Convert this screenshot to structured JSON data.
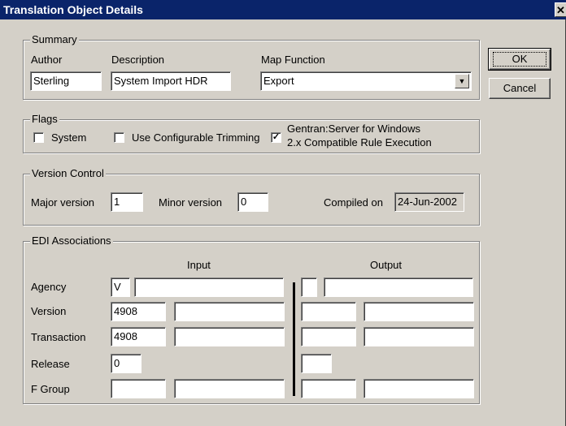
{
  "window": {
    "title": "Translation Object Details",
    "close_glyph": "✕"
  },
  "buttons": {
    "ok": "OK",
    "cancel": "Cancel"
  },
  "summary": {
    "legend": "Summary",
    "author_label": "Author",
    "author_value": "Sterling",
    "description_label": "Description",
    "description_value": "System Import HDR",
    "map_function_label": "Map Function",
    "map_function_value": "Export"
  },
  "flags": {
    "legend": "Flags",
    "system_label": "System",
    "system_checked": false,
    "trimming_label": "Use Configurable Trimming",
    "trimming_checked": false,
    "compat_checked": true,
    "compat_line1": "Gentran:Server for Windows",
    "compat_line2": "2.x Compatible Rule Execution",
    "check_glyph": "✓"
  },
  "version_control": {
    "legend": "Version Control",
    "major_label": "Major version",
    "major_value": "1",
    "minor_label": "Minor version",
    "minor_value": "0",
    "compiled_label": "Compiled on",
    "compiled_value": "24-Jun-2002"
  },
  "edi": {
    "legend": "EDI Associations",
    "input_header": "Input",
    "output_header": "Output",
    "rows": {
      "agency": {
        "label": "Agency",
        "input_code": "V"
      },
      "version": {
        "label": "Version",
        "input_code": "4908"
      },
      "transaction": {
        "label": "Transaction",
        "input_code": "4908"
      },
      "release": {
        "label": "Release",
        "input_code": "0"
      },
      "fgroup": {
        "label": "F Group",
        "input_code": ""
      }
    }
  }
}
